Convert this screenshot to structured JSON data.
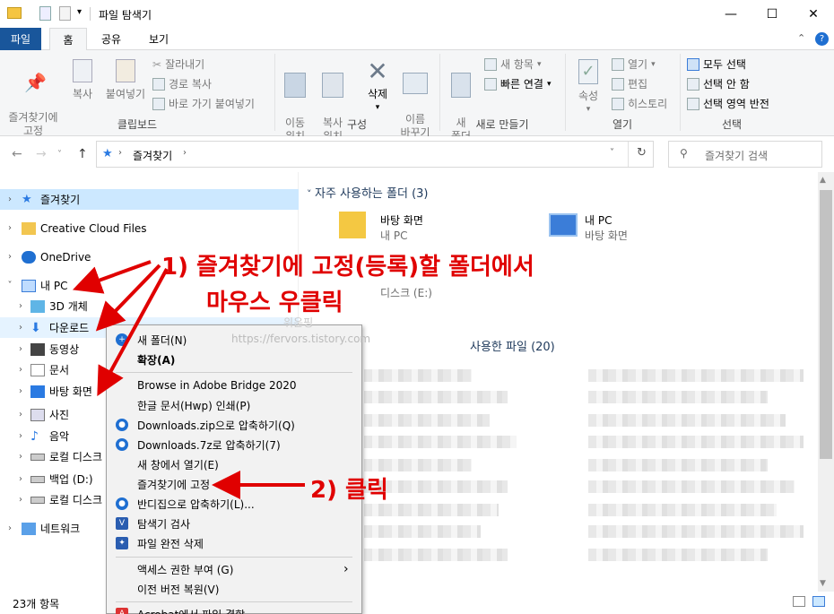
{
  "window": {
    "title": "파일 탐색기",
    "minimize": "—",
    "maximize": "☐",
    "close": "✕"
  },
  "tabs": [
    {
      "label": "파일"
    },
    {
      "label": "홈"
    },
    {
      "label": "공유"
    },
    {
      "label": "보기"
    }
  ],
  "ribbon": {
    "clipboard": {
      "pin": "즐겨찾기에\n고정",
      "copy": "복사",
      "paste": "붙여넣기",
      "cut": "잘라내기",
      "copy_path": "경로 복사",
      "paste_shortcut": "바로 가기 붙여넣기",
      "label": "클립보드"
    },
    "organize": {
      "move": "이동\n위치",
      "copyto": "복사\n위치",
      "delete": "삭제",
      "rename": "이름\n바꾸기",
      "label": "구성"
    },
    "new": {
      "new_folder": "새\n폴더",
      "new_item": "새 항목",
      "easy_access": "빠른 연결",
      "label": "새로 만들기"
    },
    "open": {
      "properties": "속성",
      "open": "열기",
      "edit": "편집",
      "history": "히스토리",
      "label": "열기"
    },
    "select": {
      "select_all": "모두 선택",
      "select_none": "선택 안 함",
      "invert": "선택 영역 반전",
      "label": "선택"
    }
  },
  "address": {
    "path": "즐겨찾기",
    "search_placeholder": "즐겨찾기 검색"
  },
  "tree": [
    {
      "label": "즐겨찾기",
      "icon": "star-icon",
      "selected": true
    },
    {
      "label": "Creative Cloud Files",
      "icon": "creative-cloud-icon"
    },
    {
      "label": "OneDrive",
      "icon": "onedrive-icon"
    },
    {
      "label": "내 PC",
      "icon": "pc-icon",
      "expanded": true
    },
    {
      "label": "3D 개체",
      "icon": "cube-icon"
    },
    {
      "label": "다운로드",
      "icon": "download-icon",
      "highlight": true
    },
    {
      "label": "동영상",
      "icon": "video-icon"
    },
    {
      "label": "문서",
      "icon": "document-icon"
    },
    {
      "label": "바탕 화면",
      "icon": "desktop-icon"
    },
    {
      "label": "사진",
      "icon": "picture-icon"
    },
    {
      "label": "음악",
      "icon": "music-icon"
    },
    {
      "label": "로컬 디스크",
      "icon": "drive-icon"
    },
    {
      "label": "백업 (D:)",
      "icon": "drive-icon"
    },
    {
      "label": "로컬 디스크",
      "icon": "drive-icon"
    },
    {
      "label": "네트워크",
      "icon": "network-icon"
    }
  ],
  "content": {
    "frequent_header": "자주 사용하는 폴더 (3)",
    "folders": [
      {
        "name": "바탕 화면",
        "sub": "내 PC"
      },
      {
        "name": "내 PC",
        "sub": "바탕 화면"
      },
      {
        "name": "",
        "sub": "디스크 (E:)"
      }
    ],
    "recent_header": "사용한 파일 (20)"
  },
  "context_menu": [
    {
      "label": "새 폴더(N)",
      "icon": true
    },
    {
      "label": "확장(A)",
      "bold": true
    },
    {
      "sep": true
    },
    {
      "label": "Browse in Adobe Bridge 2020"
    },
    {
      "label": "한글 문서(Hwp) 인쇄(P)"
    },
    {
      "label": "Downloads.zip으로 압축하기(Q)",
      "icon": true
    },
    {
      "label": "Downloads.7z로 압축하기(7)",
      "icon": true
    },
    {
      "label": "새 창에서 열기(E)"
    },
    {
      "label": "즐겨찾기에 고정"
    },
    {
      "label": "반디집으로 압축하기(L)...",
      "icon": true
    },
    {
      "label": "탐색기 검사",
      "icon": true
    },
    {
      "label": "파일 완전 삭제",
      "icon": true
    },
    {
      "sep": true
    },
    {
      "label": "액세스 권한 부여 (G)",
      "arrow": "›"
    },
    {
      "label": "이전 버전 복원(V)"
    },
    {
      "sep": true
    },
    {
      "label": "Acrobat에서 파일 결합"
    }
  ],
  "status": {
    "count": "23개 항목"
  },
  "annotations": {
    "step1_line1": "1) 즐겨찾기에 고정(등록)할 폴더에서",
    "step1_line2": "마우스 우클릭",
    "step2": "2) 클릭",
    "watermark1": "워운핑",
    "watermark2": "https://fervors.tistory.com"
  },
  "colors": {
    "accent": "#19569b",
    "annot": "#e00000",
    "selection": "#cce8ff"
  }
}
